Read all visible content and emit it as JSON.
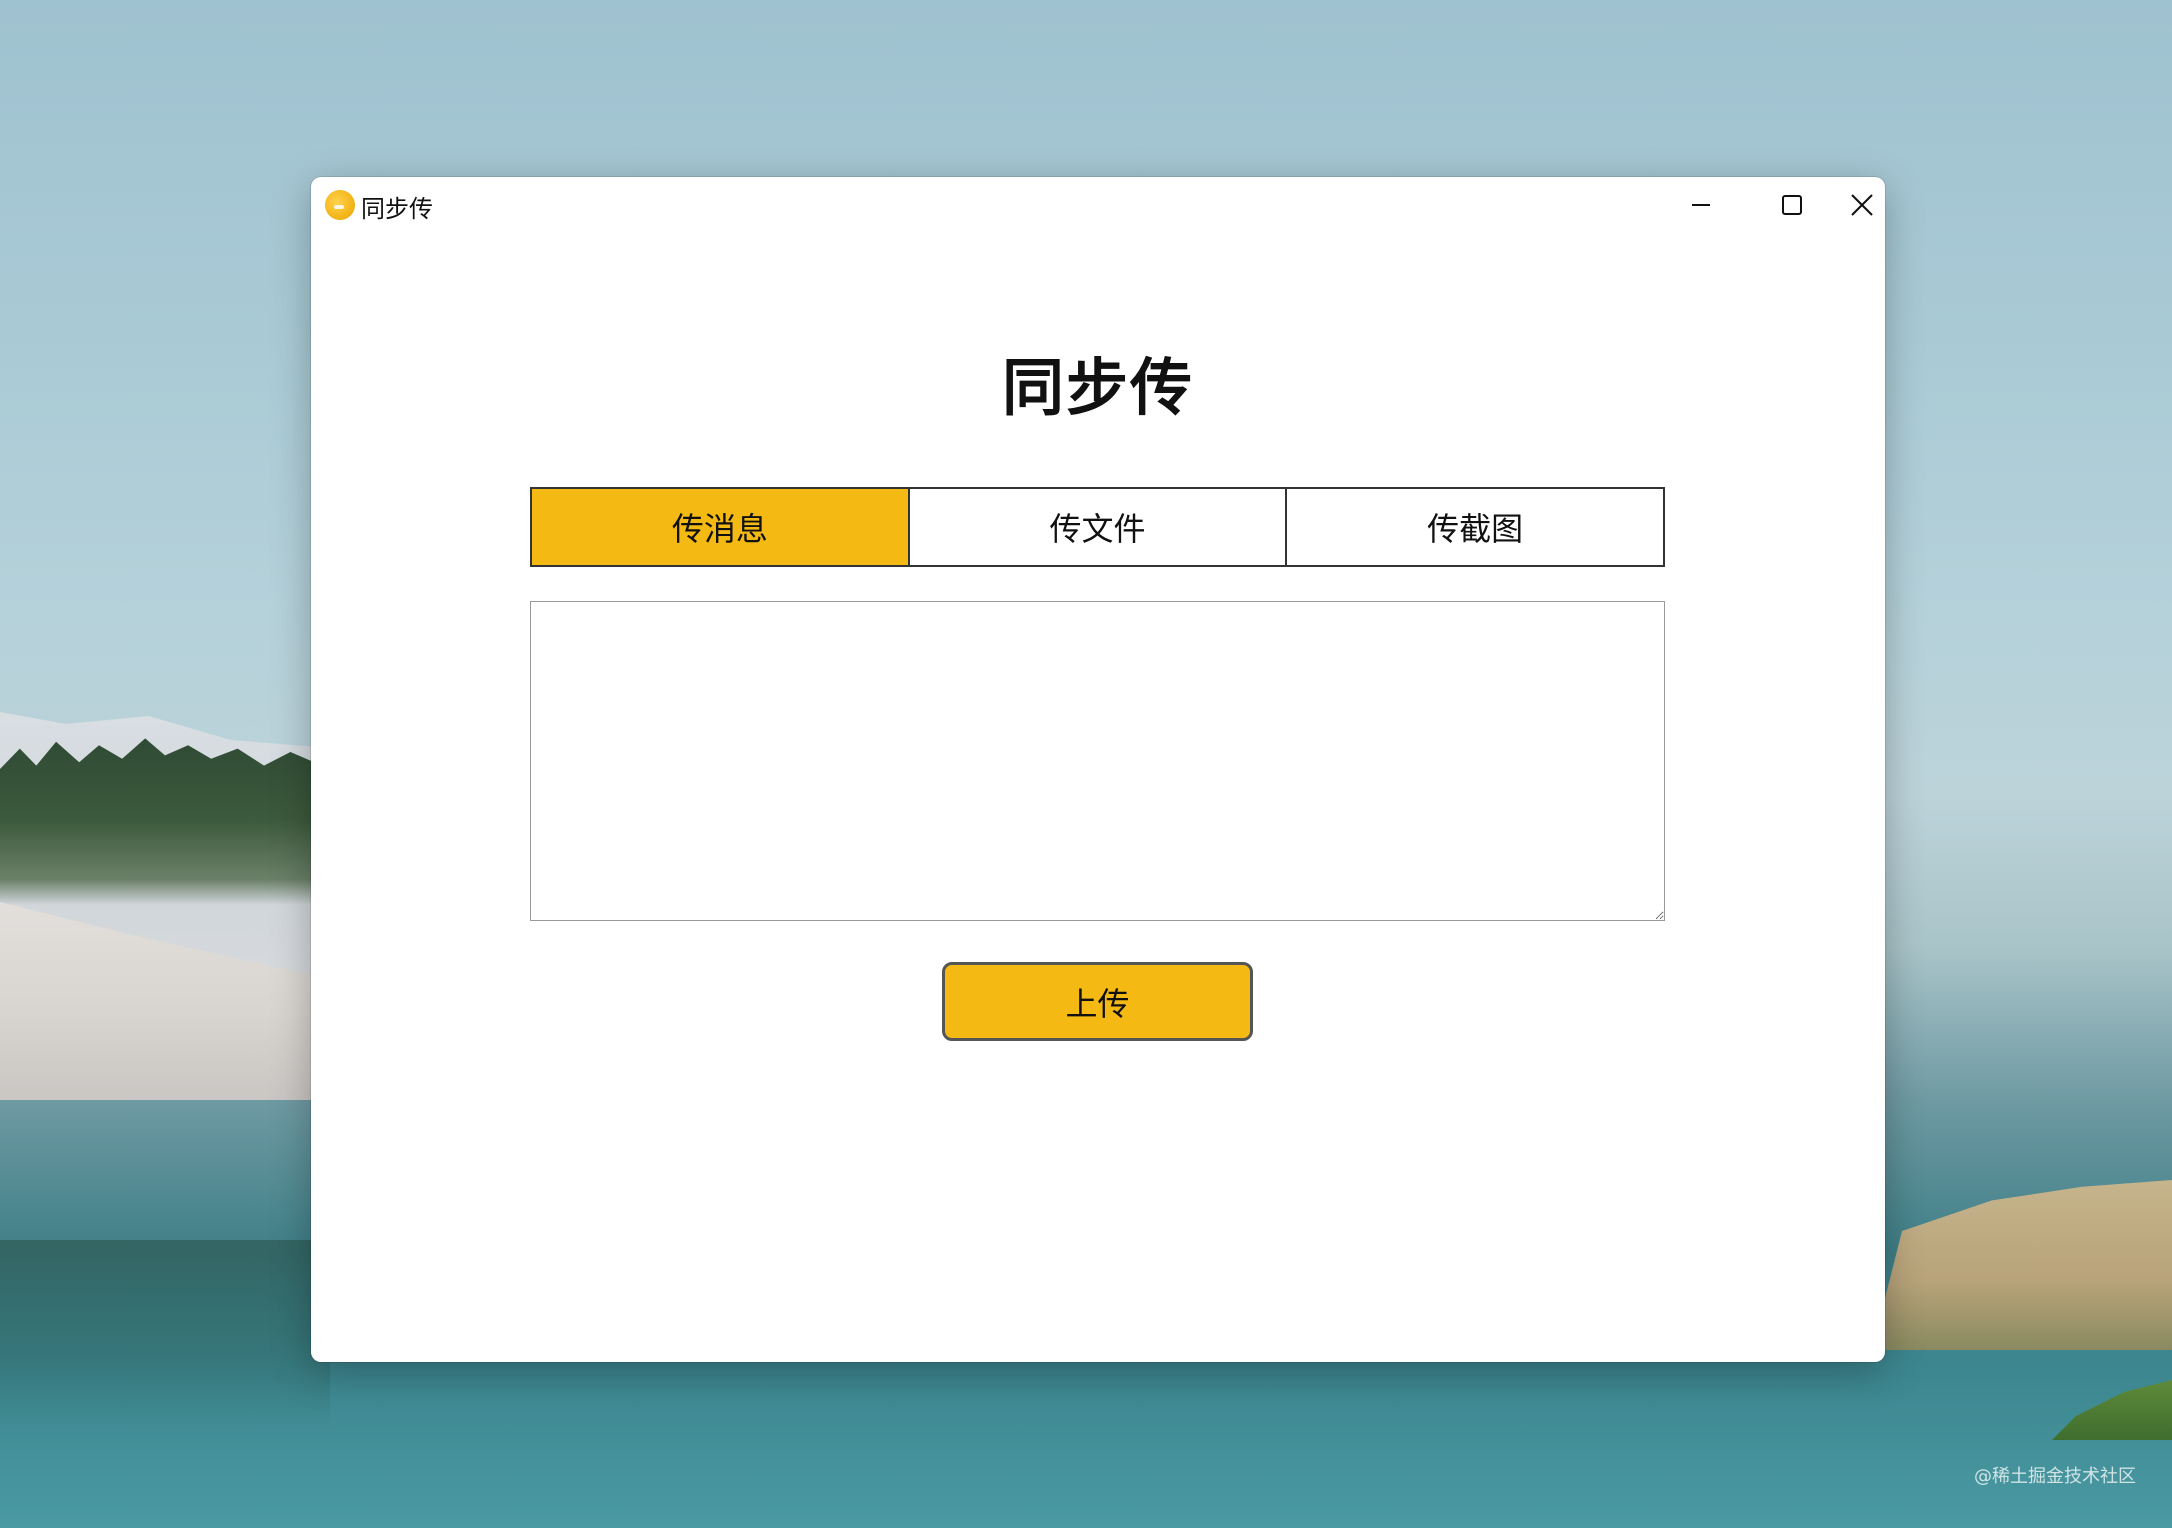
{
  "window": {
    "title": "同步传",
    "controls": {
      "minimize_icon": "minimize-icon",
      "maximize_icon": "maximize-icon",
      "close_icon": "close-icon"
    }
  },
  "main": {
    "heading": "同步传",
    "tabs": [
      {
        "label": "传消息",
        "active": true
      },
      {
        "label": "传文件",
        "active": false
      },
      {
        "label": "传截图",
        "active": false
      }
    ],
    "message_input": {
      "value": "",
      "placeholder": ""
    },
    "upload_label": "上传"
  },
  "desktop": {
    "watermark": "@稀土掘金技术社区"
  },
  "colors": {
    "accent": "#f5b914",
    "text": "#111111",
    "border": "#333333"
  }
}
